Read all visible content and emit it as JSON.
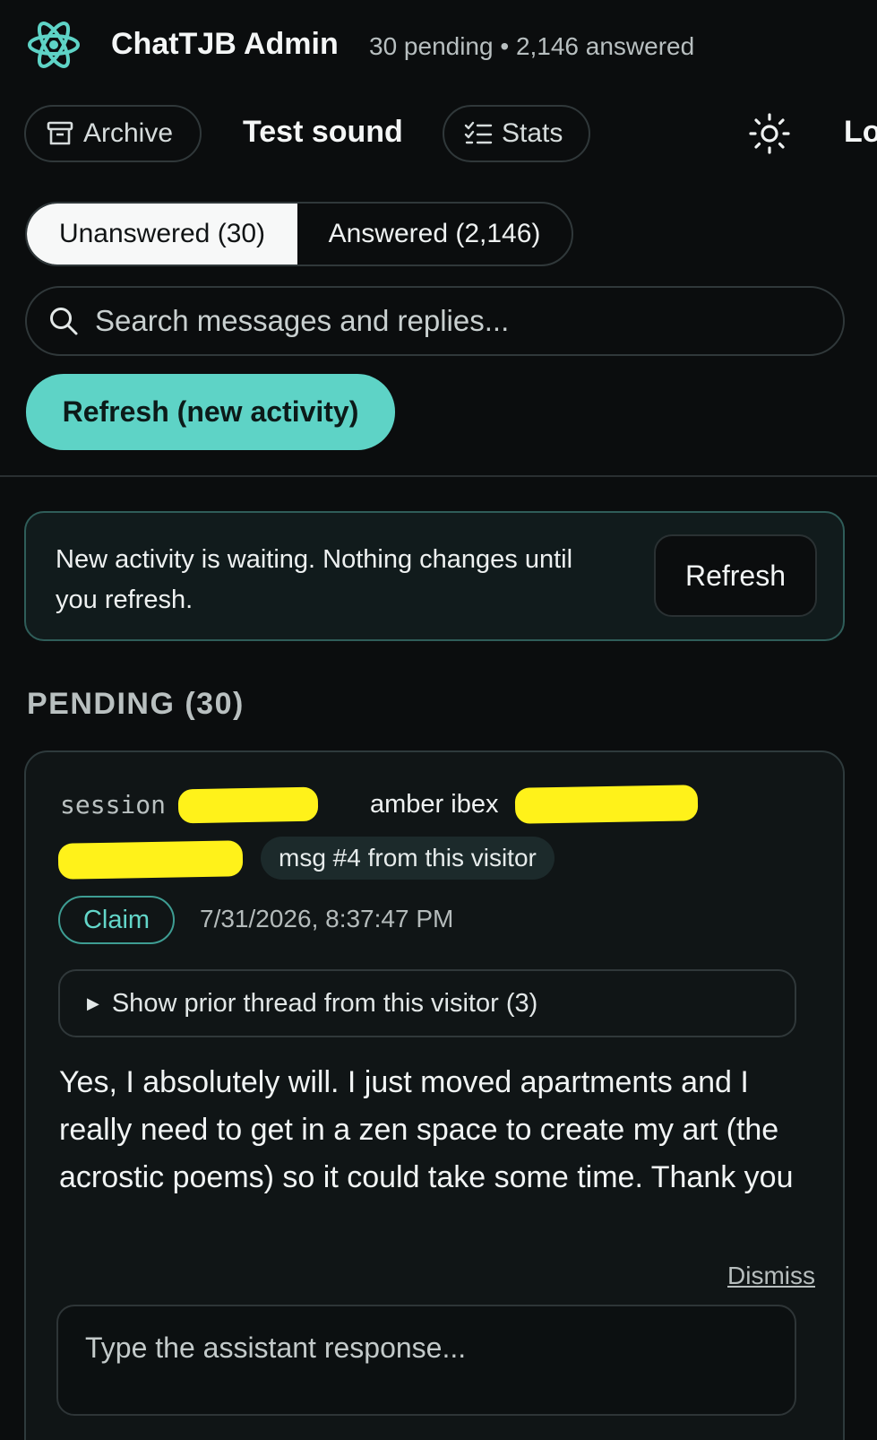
{
  "header": {
    "title": "ChatTJB Admin",
    "subtitle": "30 pending • 2,146 answered",
    "logo_icon": "atom-icon",
    "accent_color": "#5ed3c6"
  },
  "toolbar": {
    "archive_label": "Archive",
    "archive_icon": "archive-icon",
    "test_sound_label": "Test sound",
    "stats_label": "Stats",
    "stats_icon": "checklist-icon",
    "theme_icon": "sun-icon",
    "logout_partial": "Lo"
  },
  "tabs": [
    {
      "label": "Unanswered (30)",
      "active": true
    },
    {
      "label": "Answered (2,146)",
      "active": false
    }
  ],
  "search": {
    "placeholder": "Search messages and replies..."
  },
  "refresh_button": "Refresh (new activity)",
  "notice": {
    "text": "New activity is waiting. Nothing changes until you refresh.",
    "button": "Refresh"
  },
  "pending": {
    "heading": "PENDING (30)",
    "card": {
      "session_label": "session",
      "visitor_name": "amber ibex",
      "msg_badge": "msg #4 from this visitor",
      "claim_label": "Claim",
      "timestamp": "7/31/2026, 8:37:47 PM",
      "thread_toggle": "Show prior thread from this visitor (3)",
      "message": "Yes, I absolutely will. I just moved apartments and I really need to get in a zen space to create my art (the acrostic poems) so it could take some time. Thank you",
      "dismiss_label": "Dismiss",
      "response_placeholder": "Type the assistant response..."
    }
  }
}
